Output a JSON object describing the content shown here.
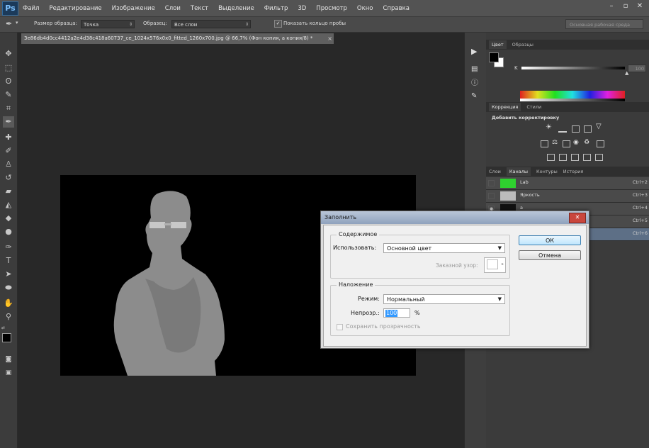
{
  "app": {
    "logo": "Ps",
    "menu": [
      "Файл",
      "Редактирование",
      "Изображение",
      "Слои",
      "Текст",
      "Выделение",
      "Фильтр",
      "3D",
      "Просмотр",
      "Окно",
      "Справка"
    ],
    "window_controls": [
      "–",
      "▫",
      "✕"
    ]
  },
  "options_bar": {
    "sample_size_label": "Размер образца:",
    "sample_size_value": "Точка",
    "sample_label": "Образец:",
    "sample_value": "Все слои",
    "show_ring_label": "Показать кольцо пробы",
    "workspace_placeholder": "Основная рабочая среда"
  },
  "document": {
    "tab_title": "3e86db4d0cc4412a2e4d38c418a60737_ce_1024x576x0x0_fitted_1260x700.jpg @ 66,7% (Фон копия, а копия/8) *",
    "close": "×"
  },
  "color_panel": {
    "tabs": [
      "Цвет",
      "Образцы"
    ],
    "channel_label": "K",
    "value": "100"
  },
  "adjustments_panel": {
    "tabs": [
      "Коррекция",
      "Стили"
    ],
    "header": "Добавить корректировку"
  },
  "layers_panel": {
    "tabs": [
      "Слои",
      "Каналы",
      "Контуры",
      "История"
    ],
    "rows": [
      {
        "name": "Lab",
        "shortcut": "Ctrl+2"
      },
      {
        "name": "Яркость",
        "shortcut": "Ctrl+3"
      },
      {
        "name": "a",
        "shortcut": "Ctrl+4"
      },
      {
        "name": "b",
        "shortcut": "Ctrl+5"
      },
      {
        "name": "",
        "shortcut": "Ctrl+6"
      }
    ]
  },
  "fill_dialog": {
    "title": "Заполнить",
    "close": "✕",
    "content_group": "Содержимое",
    "use_label": "Использовать:",
    "use_value": "Основной цвет",
    "pattern_label": "Заказной узор:",
    "blending_group": "Наложение",
    "mode_label": "Режим:",
    "mode_value": "Нормальный",
    "opacity_label": "Непрозр.:",
    "opacity_value": "100",
    "opacity_unit": "%",
    "preserve_label": "Сохранить прозрачность",
    "ok_label": "ОК",
    "cancel_label": "Отмена"
  },
  "colors": {
    "menubar": "#535353",
    "workspace": "#282828",
    "foreground_swatch": "#000000",
    "background_swatch": "#ffffff",
    "lab_thumb": "#2fd12f"
  }
}
